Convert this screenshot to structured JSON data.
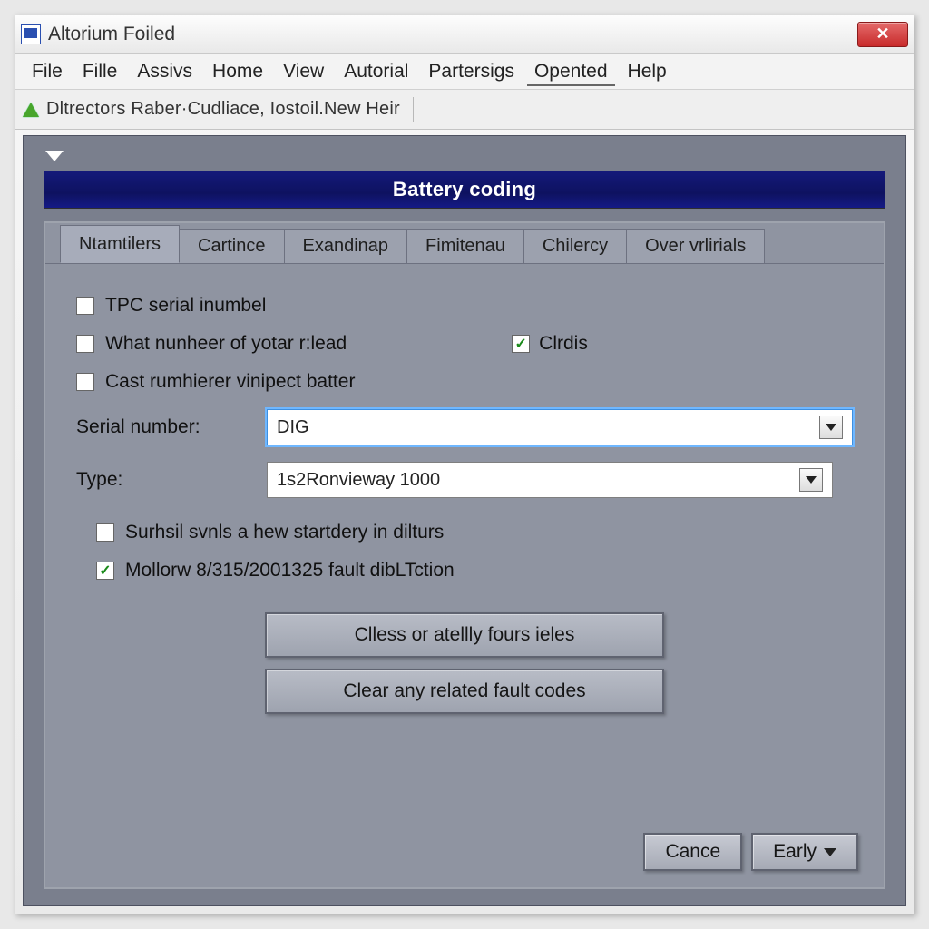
{
  "window": {
    "title": "Altorium Foiled"
  },
  "menu": {
    "items": [
      "File",
      "Fille",
      "Assivs",
      "Home",
      "View",
      "Autorial",
      "Partersigs",
      "Opented",
      "Help"
    ],
    "underlined_index": 7
  },
  "toolbar": {
    "text": "Dltrectors  Raber·Cudliace,  Iostoil.New  Heir"
  },
  "section": {
    "title": "Battery coding"
  },
  "tabs": {
    "items": [
      "Ntamtilers",
      "Cartince",
      "Exandinap",
      "Fimitenau",
      "Chilercy",
      "Over vrlirials"
    ],
    "active_index": 0
  },
  "form": {
    "check_tpc": {
      "label": "TPC serial inumbel",
      "checked": false
    },
    "check_what": {
      "label": "What nunheer of yotar r:lead",
      "checked": false
    },
    "check_clrdis": {
      "label": "Clrdis",
      "checked": true
    },
    "check_cast": {
      "label": "Cast rumhierer vinipect batter",
      "checked": false
    },
    "serial_label": "Serial number:",
    "serial_value": "DIG",
    "type_label": "Type:",
    "type_value": "1s2Ronvieway 1000",
    "check_surhsil": {
      "label": "Surhsil svnls a hew startdery in dilturs",
      "checked": false
    },
    "check_mollorw": {
      "label": "Mollorw 8/315/2001325 fault dibLTction",
      "checked": true
    }
  },
  "buttons": {
    "big1": "Clless or atellly fours ieles",
    "big2": "Clear any related fault codes",
    "cancel": "Cance",
    "early": "Early"
  }
}
